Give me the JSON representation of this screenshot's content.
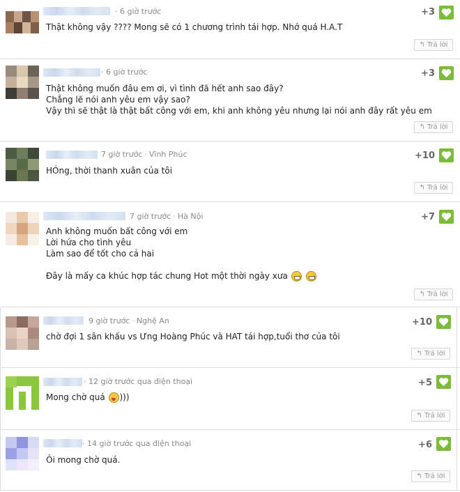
{
  "comments": [
    {
      "time": "6 giờ trước",
      "location": "",
      "lines": [
        "Thật không vậy ???? Mong sẽ có 1 chương trình tái hợp. Nhớ quá H.A.T"
      ],
      "score": "+3",
      "reply_label": "Trả lời"
    },
    {
      "time": "6 giờ trước",
      "location": "",
      "lines": [
        "Thật không muốn đâu em ơi, vì tình đã hết anh sao đây?",
        "Chẳng lẽ nói anh yêu em vậy sao?",
        "Vậy thì sẽ thật là thật bất công với em, khi anh không yêu nhưng lại nói anh đây rất yêu em"
      ],
      "score": "+3",
      "reply_label": "Trả lời"
    },
    {
      "time": "7 giờ trước",
      "location": "Vĩnh Phúc",
      "lines": [
        "HÓng, thời thanh xuân của tôi"
      ],
      "score": "+10",
      "reply_label": "Trả lời"
    },
    {
      "time": "7 giờ trước",
      "location": "Hà Nội",
      "lines": [
        "Anh không muốn bất công với em",
        "Lời hứa cho tình yêu",
        "Làm sao để tốt cho cả hai",
        "",
        "Đây là mấy ca khúc hợp tác chung Hot một thời ngày xưa"
      ],
      "score": "+7",
      "reply_label": "Trả lời"
    },
    {
      "time": "9 giờ trước",
      "location": "Nghệ An",
      "lines": [
        "chờ đợi 1 sân khấu vs Ưng Hoàng Phúc và HAT tái hợp,tuổi thơ của tôi"
      ],
      "score": "+10",
      "reply_label": "Trả lời"
    },
    {
      "time": "12 giờ trước qua điện thoại",
      "location": "",
      "lines": [
        "Mong chờ quá"
      ],
      "line_suffix": ")))",
      "score": "+5",
      "reply_label": "Trả lời"
    },
    {
      "time": "14 giờ trước qua điện thoại",
      "location": "",
      "lines": [
        "Ôi mong chờ quá."
      ],
      "score": "+6",
      "reply_label": "Trả lời"
    }
  ],
  "colors": {
    "like_green": "#7cbb3b",
    "meta_gray": "#888888"
  },
  "icons": {
    "like": "heart-icon",
    "reply": "reply-arrow-icon"
  }
}
